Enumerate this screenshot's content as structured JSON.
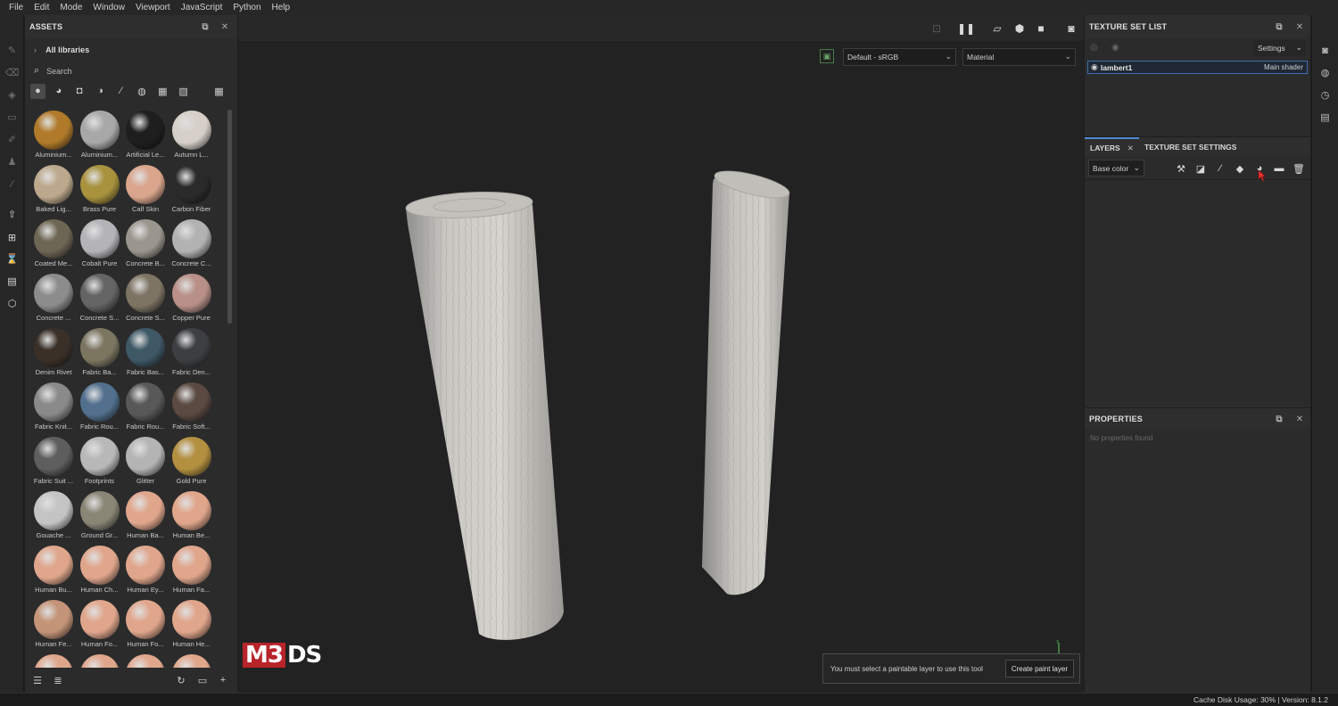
{
  "menu": [
    "File",
    "Edit",
    "Mode",
    "Window",
    "Viewport",
    "JavaScript",
    "Python",
    "Help"
  ],
  "assets": {
    "title": "ASSETS",
    "library": "All libraries",
    "search_placeholder": "Search",
    "filter_icons": [
      "material-icon",
      "smart-material-icon",
      "mask-icon",
      "procedural-icon",
      "brush-icon",
      "particle-icon",
      "texture-icon",
      "environment-icon"
    ],
    "items": [
      {
        "label": "Aluminium...",
        "color": "#b07a2a"
      },
      {
        "label": "Aluminium...",
        "color": "#a8a8a8"
      },
      {
        "label": "Artificial Le...",
        "color": "#1e1e1e"
      },
      {
        "label": "Autumn L...",
        "color": "#d6d0c8"
      },
      {
        "label": "Baked Lig...",
        "color": "#bca88c"
      },
      {
        "label": "Brass Pure",
        "color": "#a8923e"
      },
      {
        "label": "Calf Skin",
        "color": "#d9a58c"
      },
      {
        "label": "Carbon Fiber",
        "color": "#2a2a2a"
      },
      {
        "label": "Coated Me...",
        "color": "#6e6654"
      },
      {
        "label": "Cobalt Pure",
        "color": "#b4b4b8"
      },
      {
        "label": "Concrete B...",
        "color": "#9a968e"
      },
      {
        "label": "Concrete C...",
        "color": "#b2b2b2"
      },
      {
        "label": "Concrete ...",
        "color": "#8c8c8c"
      },
      {
        "label": "Concrete S...",
        "color": "#646464"
      },
      {
        "label": "Concrete S...",
        "color": "#7e7464"
      },
      {
        "label": "Copper Pure",
        "color": "#b89088"
      },
      {
        "label": "Denim Rivet",
        "color": "#3a3028"
      },
      {
        "label": "Fabric Ba...",
        "color": "#7c7660"
      },
      {
        "label": "Fabric Bas...",
        "color": "#3e5866"
      },
      {
        "label": "Fabric Den...",
        "color": "#3c3e42"
      },
      {
        "label": "Fabric Knit...",
        "color": "#8a8a8a"
      },
      {
        "label": "Fabric Rou...",
        "color": "#52708e"
      },
      {
        "label": "Fabric Rou...",
        "color": "#585858"
      },
      {
        "label": "Fabric Soft...",
        "color": "#5a4a42"
      },
      {
        "label": "Fabric Suit ...",
        "color": "#5e5e5e"
      },
      {
        "label": "Footprints",
        "color": "#b8b8b8"
      },
      {
        "label": "Glitter",
        "color": "#b4b4b4"
      },
      {
        "label": "Gold Pure",
        "color": "#b39040"
      },
      {
        "label": "Gouache ...",
        "color": "#c4c4c4"
      },
      {
        "label": "Ground Gr...",
        "color": "#8a8676"
      },
      {
        "label": "Human Ba...",
        "color": "#e0a68c"
      },
      {
        "label": "Human Be...",
        "color": "#e0a68c"
      },
      {
        "label": "Human Bu...",
        "color": "#e0a68c"
      },
      {
        "label": "Human Ch...",
        "color": "#e0a68c"
      },
      {
        "label": "Human Ey...",
        "color": "#e0a68c"
      },
      {
        "label": "Human Fa...",
        "color": "#e0a68c"
      },
      {
        "label": "Human Fe...",
        "color": "#c49478"
      },
      {
        "label": "Human Fo...",
        "color": "#e0a68c"
      },
      {
        "label": "Human Fo...",
        "color": "#e0a68c"
      },
      {
        "label": "Human He...",
        "color": "#e0a68c"
      },
      {
        "label": "",
        "color": "#e0a68c"
      },
      {
        "label": "",
        "color": "#e0a68c"
      },
      {
        "label": "",
        "color": "#e0a68c"
      },
      {
        "label": "",
        "color": "#e0a68c"
      }
    ]
  },
  "viewport": {
    "colorspace": "Default - sRGB",
    "channel": "Material",
    "logo_left": "M3",
    "logo_right": "DS",
    "toast_message": "You must select a paintable layer to use this tool",
    "toast_button": "Create paint layer"
  },
  "texture_set_list": {
    "title": "TEXTURE SET LIST",
    "settings": "Settings",
    "item_name": "lambert1",
    "item_shader": "Main shader"
  },
  "layers": {
    "tab_layers": "LAYERS",
    "tab_tss": "TEXTURE SET SETTINGS",
    "channel": "Base color"
  },
  "properties": {
    "title": "PROPERTIES",
    "empty": "No properties found"
  },
  "status": "Cache Disk Usage:   30% | Version: 8.1.2"
}
